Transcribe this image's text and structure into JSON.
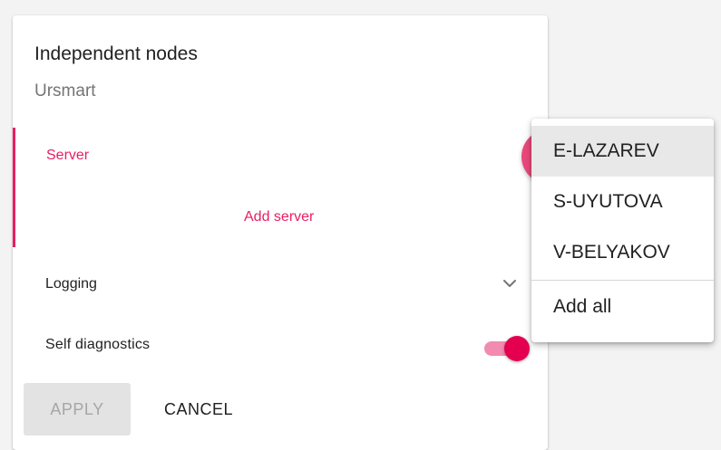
{
  "card": {
    "title": "Independent nodes",
    "subtitle": "Ursmart"
  },
  "server": {
    "label": "Server",
    "add_label": "Add server"
  },
  "logging": {
    "label": "Logging",
    "expand_icon": "chevron-down-icon"
  },
  "self_diagnostics": {
    "label": "Self diagnostics",
    "enabled": true
  },
  "actions": {
    "apply_label": "APPLY",
    "apply_disabled": true,
    "cancel_label": "CANCEL"
  },
  "dropdown": {
    "items": [
      {
        "label": "E-LAZAREV",
        "selected": true
      },
      {
        "label": "S-UYUTOVA",
        "selected": false
      },
      {
        "label": "V-BELYAKOV",
        "selected": false
      }
    ],
    "footer_label": "Add all"
  },
  "colors": {
    "accent": "#e91e63",
    "toggle_thumb": "#e5004f",
    "toggle_track": "#f28bb0",
    "disabled_button_bg": "#e3e3e3",
    "disabled_button_text": "#a6a6a6",
    "background": "#f3f3f3"
  }
}
